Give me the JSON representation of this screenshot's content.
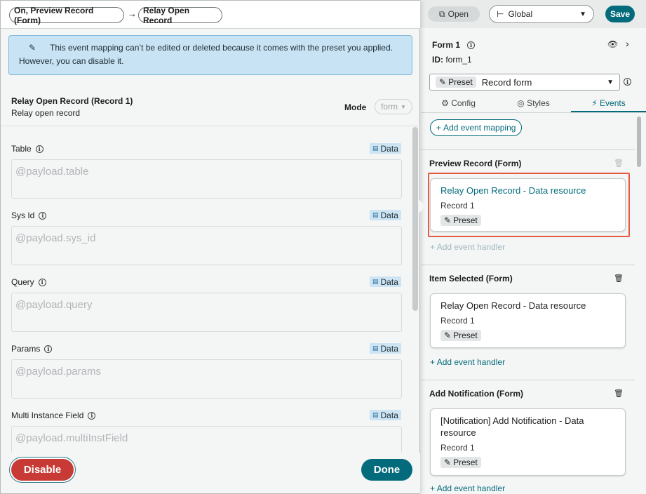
{
  "topbar": {
    "open_label": "Open",
    "scope_value": "Global",
    "save_label": "Save"
  },
  "component": {
    "name": "Form 1",
    "id_label": "ID:",
    "id_value": "form_1",
    "preset_tag": "Preset",
    "preset_value": "Record form"
  },
  "tabs": [
    {
      "label": "Config",
      "icon": "gear-icon"
    },
    {
      "label": "Styles",
      "icon": "palette-icon"
    },
    {
      "label": "Events",
      "icon": "bolt-icon",
      "active": true
    }
  ],
  "events": {
    "add_mapping_label": "Add event mapping",
    "add_handler_label": "Add event handler",
    "sections": [
      {
        "title": "Preview Record (Form)",
        "handler_title": "Relay Open Record - Data resource",
        "handler_sub": "Record 1",
        "tag": "Preset"
      },
      {
        "title": "Item Selected (Form)",
        "handler_title": "Relay Open Record - Data resource",
        "handler_sub": "Record 1",
        "tag": "Preset"
      },
      {
        "title": "Add Notification (Form)",
        "handler_title": "[Notification] Add Notification - Data resource",
        "handler_sub": "Record 1",
        "tag": "Preset"
      }
    ]
  },
  "modal": {
    "breadcrumb": [
      "On, Preview Record (Form)",
      "Relay Open Record"
    ],
    "breadcrumb_arrow": "→",
    "notice": "This event mapping can’t be edited or deleted because it comes with the preset you applied. However, you can disable it.",
    "action_title": "Relay Open Record (Record 1)",
    "action_sub": "Relay open record",
    "mode_label": "Mode",
    "mode_value": "form",
    "data_tag": "Data",
    "fields": [
      {
        "label": "Table",
        "value": "@payload.table"
      },
      {
        "label": "Sys Id",
        "value": "@payload.sys_id"
      },
      {
        "label": "Query",
        "value": "@payload.query"
      },
      {
        "label": "Params",
        "value": "@payload.params"
      },
      {
        "label": "Multi Instance Field",
        "value": "@payload.multiInstField"
      }
    ],
    "disable_label": "Disable",
    "done_label": "Done"
  },
  "colors": {
    "accent": "#046b7c",
    "danger": "#c83a35",
    "highlight": "#e55a43",
    "notice_bg": "#c7e3f4"
  }
}
